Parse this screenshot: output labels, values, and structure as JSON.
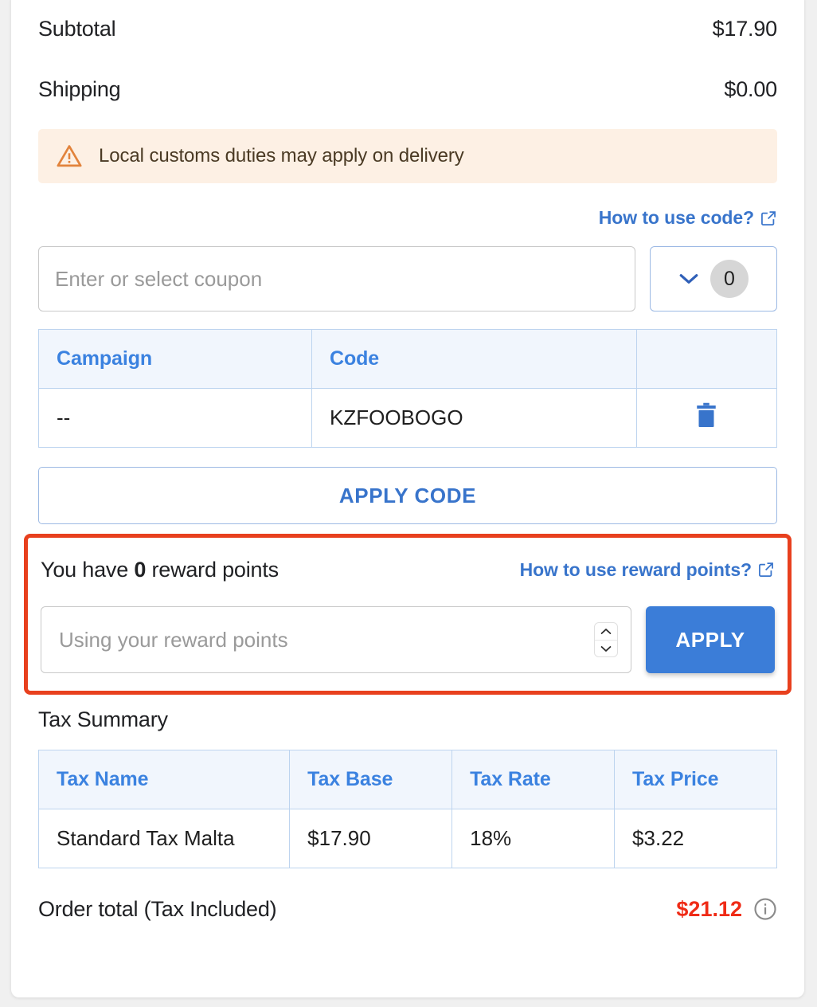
{
  "summary": {
    "subtotal": {
      "label": "Subtotal",
      "value": "$17.90"
    },
    "shipping": {
      "label": "Shipping",
      "value": "$0.00"
    }
  },
  "warning": {
    "icon": "warning-triangle-icon",
    "text": "Local customs duties may apply on delivery"
  },
  "coupon": {
    "help_link": "How to use code?",
    "help_link_icon": "external-link-icon",
    "input_placeholder": "Enter or select coupon",
    "input_value": "",
    "dropdown_icon": "chevron-down-icon",
    "dropdown_count": "0",
    "apply_code_label": "APPLY CODE",
    "table": {
      "headers": [
        "Campaign",
        "Code",
        ""
      ],
      "rows": [
        {
          "campaign": "--",
          "code": "KZFOOBOGO",
          "delete_icon": "trash-icon"
        }
      ]
    }
  },
  "reward": {
    "label_prefix": "You have ",
    "points": "0",
    "label_suffix": " reward points",
    "help_link": "How to use reward points?",
    "help_link_icon": "external-link-icon",
    "input_placeholder": "Using your reward points",
    "input_value": "",
    "spinner_icon": "number-spinner-icon",
    "apply_label": "APPLY",
    "highlight_color": "#e8401e"
  },
  "tax": {
    "title": "Tax Summary",
    "headers": [
      "Tax Name",
      "Tax Base",
      "Tax Rate",
      "Tax Price"
    ],
    "rows": [
      {
        "name": "Standard Tax Malta",
        "base": "$17.90",
        "rate": "18%",
        "price": "$3.22"
      }
    ]
  },
  "total": {
    "label": "Order total (Tax Included)",
    "value": "$21.12",
    "value_color": "#ef2b16",
    "info_icon": "info-circle-icon"
  }
}
